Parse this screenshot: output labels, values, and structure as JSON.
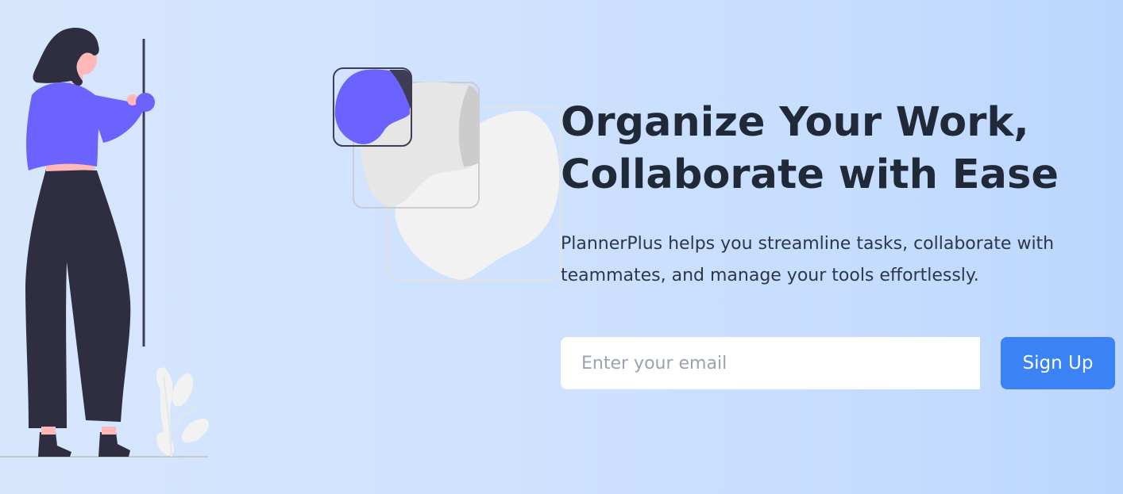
{
  "hero": {
    "headline_line1": "Organize Your Work,",
    "headline_line2": "Collaborate with Ease",
    "description": "PlannerPlus helps you streamline tasks, collaborate with teammates, and manage your tools effortlessly."
  },
  "signup": {
    "email_placeholder": "Enter your email",
    "email_value": "",
    "button_label": "Sign Up"
  },
  "illustrations": {
    "left": "woman-standing-illustration",
    "center": "overlapping-cards-illustration"
  },
  "colors": {
    "accent": "#3b82f6",
    "illustration_purple": "#6c63ff",
    "illustration_dark": "#2f2e41",
    "headline": "#1f2937"
  }
}
